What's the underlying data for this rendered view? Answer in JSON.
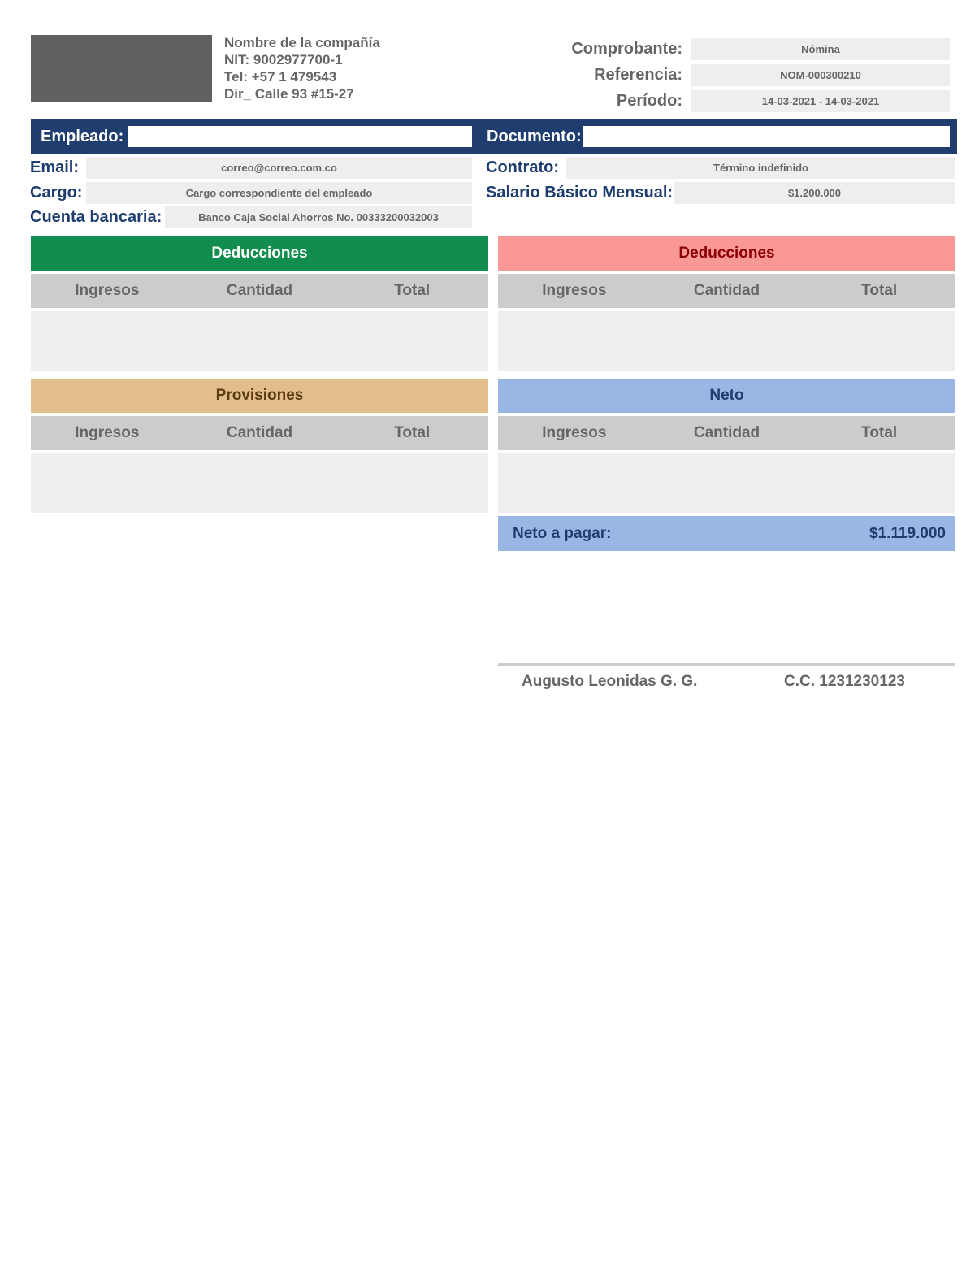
{
  "company": {
    "name": "Nombre de la compañía",
    "nit": "NIT: 9002977700-1",
    "tel": "Tel: +57 1 479543",
    "address": "Dir_ Calle 93 #15-27"
  },
  "meta": {
    "comprobante_label": "Comprobante:",
    "comprobante_value": "Nómina",
    "referencia_label": "Referencia:",
    "referencia_value": "NOM-000300210",
    "periodo_label": "Período:",
    "periodo_value": "14-03-2021 - 14-03-2021"
  },
  "employee": {
    "empleado_label": "Empleado:",
    "empleado_value": "",
    "documento_label": "Documento:",
    "documento_value": ""
  },
  "info": {
    "email_label": "Email:",
    "email_value": "correo@correo.com.co",
    "cargo_label": "Cargo:",
    "cargo_value": "Cargo correspondiente del empleado",
    "cuenta_label": "Cuenta bancaria:",
    "cuenta_value": "Banco Caja Social Ahorros No. 00333200032003",
    "contrato_label": "Contrato:",
    "contrato_value": "Término indefinido",
    "salario_label": "Salario Básico Mensual:",
    "salario_value": "$1.200.000"
  },
  "sections": {
    "ingresos_title": "Deducciones",
    "deducciones_title": "Deducciones",
    "provisiones_title": "Provisiones",
    "neto_title": "Neto",
    "col_ingresos": "Ingresos",
    "col_cantidad": "Cantidad",
    "col_total": "Total"
  },
  "net": {
    "label": "Neto a pagar:",
    "value": "$1.119.000"
  },
  "signature": {
    "name": "Augusto Leonidas G. G.",
    "id": "C.C. 1231230123"
  },
  "colors": {
    "navy": "#1f3d6e",
    "green": "#118e4e",
    "pink": "#fa9896",
    "dark_red": "#8b0000",
    "tan": "#e2be8c",
    "brown": "#5b3a0e",
    "blue": "#99b7e5"
  }
}
